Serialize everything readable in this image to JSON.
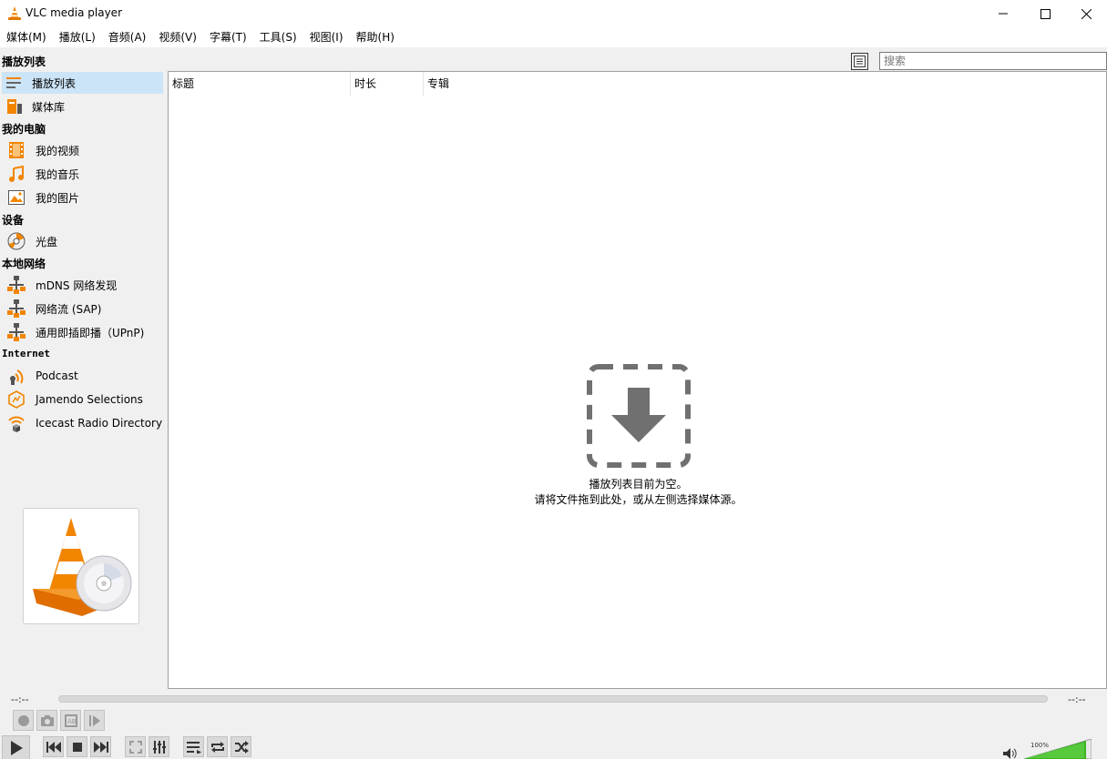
{
  "window": {
    "title": "VLC media player"
  },
  "menu": [
    "媒体(M)",
    "播放(L)",
    "音频(A)",
    "视频(V)",
    "字幕(T)",
    "工具(S)",
    "视图(I)",
    "帮助(H)"
  ],
  "sidebar": {
    "title": "播放列表",
    "playlist_items": [
      {
        "label": "播放列表",
        "icon": "playlist-icon",
        "selected": true
      },
      {
        "label": "媒体库",
        "icon": "media-library-icon",
        "selected": false
      }
    ],
    "my_computer": {
      "label": "我的电脑",
      "items": [
        {
          "label": "我的视频",
          "icon": "film-icon"
        },
        {
          "label": "我的音乐",
          "icon": "music-note-icon"
        },
        {
          "label": "我的图片",
          "icon": "picture-icon"
        }
      ]
    },
    "devices": {
      "label": "设备",
      "items": [
        {
          "label": "光盘",
          "icon": "disc-icon"
        }
      ]
    },
    "local_network": {
      "label": "本地网络",
      "items": [
        {
          "label": "mDNS 网络发现",
          "icon": "network-icon"
        },
        {
          "label": "网络流 (SAP)",
          "icon": "network-icon"
        },
        {
          "label": "通用即插即播（UPnP)",
          "icon": "network-icon"
        }
      ]
    },
    "internet": {
      "label": "Internet",
      "items": [
        {
          "label": "Podcast",
          "icon": "podcast-icon"
        },
        {
          "label": "Jamendo Selections",
          "icon": "jamendo-icon"
        },
        {
          "label": "Icecast Radio Directory",
          "icon": "icecast-icon"
        }
      ]
    }
  },
  "search": {
    "placeholder": "搜索"
  },
  "playlist": {
    "columns": [
      "标题",
      "时长",
      "专辑"
    ],
    "empty_line1": "播放列表目前为空。",
    "empty_line2": "请将文件拖到此处，或从左侧选择媒体源。"
  },
  "player": {
    "elapsed": "--:--",
    "remaining": "--:--",
    "volume": "100%"
  },
  "colors": {
    "accent_orange": "#f28500",
    "selected_bg": "#cce4f7",
    "volume_green": "#3cb521"
  }
}
